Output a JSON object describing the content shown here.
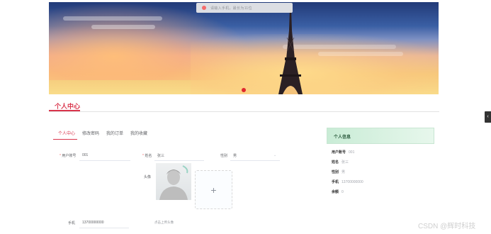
{
  "toast": {
    "text": "请输入手机，最长为11位"
  },
  "section": {
    "title": "个人中心"
  },
  "side_handle": "‹",
  "tabs": [
    "个人中心",
    "修改密码",
    "我的订单",
    "我的收藏"
  ],
  "form": {
    "username": {
      "label": "用户账号",
      "value": "001",
      "required": true
    },
    "name": {
      "label": "姓名",
      "value": "张三",
      "required": true
    },
    "gender": {
      "label": "性别",
      "value": "男"
    },
    "avatar": {
      "label": "头像",
      "upload_hint": "点击上传头像",
      "plus": "+"
    },
    "phone": {
      "label": "手机",
      "value": "13700000000"
    }
  },
  "info_card": {
    "title": "个人信息",
    "rows": [
      {
        "k": "用户账号",
        "v": "001"
      },
      {
        "k": "姓名",
        "v": "张三"
      },
      {
        "k": "性别",
        "v": "男"
      },
      {
        "k": "手机",
        "v": "13700000000"
      },
      {
        "k": "余额",
        "v": "0"
      }
    ]
  },
  "watermark": "CSDN @辉时科技",
  "colors": {
    "accent": "#d9344b",
    "card_head": "#c9ecd6"
  }
}
